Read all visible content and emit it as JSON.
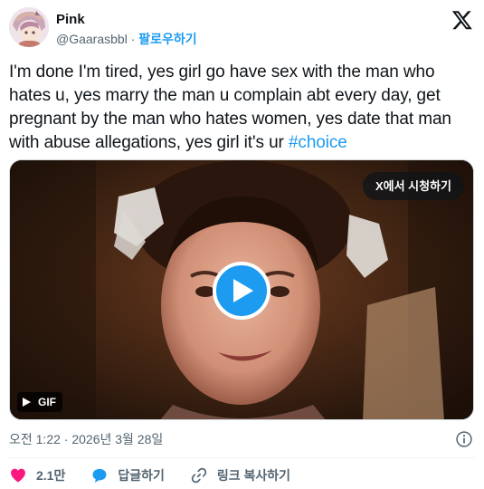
{
  "author": {
    "display_name": "Pink",
    "handle": "@Gaarasbbl",
    "separator": "·",
    "follow_label": "팔로우하기"
  },
  "tweet": {
    "text_parts": [
      "I'm done I'm tired, yes girl go have sex with the man who hates u, yes marry the man u complain abt every day, get pregnant by the man who hates women, yes date that man with abuse allegations, yes girl it's ur "
    ],
    "hashtag": "#choice"
  },
  "media": {
    "watch_label": "X에서 시청하기",
    "badge_label": "GIF"
  },
  "meta": {
    "timestamp": "오전 1:22 · 2026년 3월 28일"
  },
  "actions": {
    "like_count": "2.1만",
    "reply_label": "답글하기",
    "copy_link_label": "링크 복사하기"
  },
  "colors": {
    "accent": "#1d9bf0",
    "like": "#f91880",
    "text": "#0f1419",
    "muted": "#536471"
  },
  "icons": {
    "brand": "x-logo-icon",
    "info": "info-icon",
    "like": "heart-icon",
    "reply": "speech-bubble-icon",
    "copy": "link-icon",
    "play": "play-icon"
  }
}
